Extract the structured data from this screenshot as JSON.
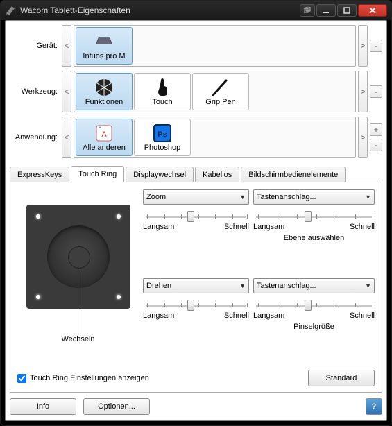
{
  "window": {
    "title": "Wacom Tablett-Eigenschaften"
  },
  "rows": {
    "device_label": "Gerät:",
    "tool_label": "Werkzeug:",
    "app_label": "Anwendung:",
    "devices": [
      {
        "label": "Intuos pro M",
        "selected": true
      }
    ],
    "tools": [
      {
        "label": "Funktionen",
        "selected": true
      },
      {
        "label": "Touch",
        "selected": false
      },
      {
        "label": "Grip Pen",
        "selected": false
      }
    ],
    "apps": [
      {
        "label": "Alle anderen",
        "selected": true
      },
      {
        "label": "Photoshop",
        "selected": false
      }
    ]
  },
  "tabs": {
    "items": [
      "ExpressKeys",
      "Touch Ring",
      "Displaywechsel",
      "Kabellos",
      "Bildschirmbedienelemente"
    ],
    "active_index": 1
  },
  "touchring": {
    "controls": [
      {
        "combo": "Zoom",
        "thumb": 45,
        "sub": ""
      },
      {
        "combo": "Tastenanschlag...",
        "thumb": 45,
        "sub": "Ebene auswählen"
      },
      {
        "combo": "Drehen",
        "thumb": 45,
        "sub": ""
      },
      {
        "combo": "Tastenanschlag...",
        "thumb": 45,
        "sub": "Pinselgröße"
      }
    ],
    "slow": "Langsam",
    "fast": "Schnell",
    "center_label": "Wechseln",
    "check_label": "Touch Ring Einstellungen anzeigen",
    "checked": true,
    "default_btn": "Standard"
  },
  "bottom": {
    "info": "Info",
    "options": "Optionen..."
  },
  "glyphs": {
    "left": "<",
    "right": ">",
    "plus": "+",
    "minus": "-",
    "help": "?"
  }
}
